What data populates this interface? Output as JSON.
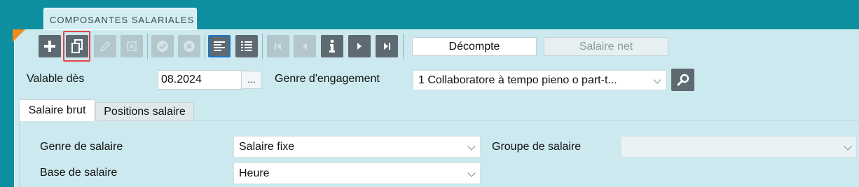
{
  "window": {
    "tab_title": "COMPOSANTES SALARIALES"
  },
  "toolbar": {
    "buttons": [
      {
        "icon": "plus-icon",
        "enabled": true
      },
      {
        "icon": "copy-document-icon",
        "enabled": true,
        "highlighted": true
      },
      {
        "icon": "edit-pencil-icon",
        "enabled": false
      },
      {
        "icon": "delete-icon",
        "enabled": false
      },
      {
        "icon": "confirm-icon",
        "enabled": false
      },
      {
        "icon": "cancel-icon",
        "enabled": false
      },
      {
        "icon": "detail-view-icon",
        "enabled": true,
        "selected": true
      },
      {
        "icon": "list-view-icon",
        "enabled": true
      },
      {
        "icon": "first-record-icon",
        "enabled": false
      },
      {
        "icon": "previous-record-icon",
        "enabled": false
      },
      {
        "icon": "info-icon",
        "enabled": true
      },
      {
        "icon": "next-record-icon",
        "enabled": true
      },
      {
        "icon": "last-record-icon",
        "enabled": true
      }
    ],
    "decompte_label": "Décompte",
    "salaire_net_label": "Salaire net"
  },
  "form": {
    "valable_des_label": "Valable dès",
    "valable_des_value": "08.2024",
    "ellipsis": "...",
    "genre_engagement_label": "Genre d'engagement",
    "genre_engagement_value": "1 Collaboratore à tempo pieno o part-t..."
  },
  "subtabs": {
    "salaire_brut": "Salaire brut",
    "positions_salaire": "Positions salaire"
  },
  "salaire_brut": {
    "genre_label": "Genre de salaire",
    "genre_value": "Salaire fixe",
    "groupe_label": "Groupe de salaire",
    "groupe_value": "",
    "base_label": "Base de salaire",
    "base_value": "Heure"
  },
  "colors": {
    "background": "#0e8fa0",
    "panel": "#cbe9ee",
    "button": "#5e6a72",
    "accent": "#f18b1e",
    "highlight": "#e5464b"
  }
}
